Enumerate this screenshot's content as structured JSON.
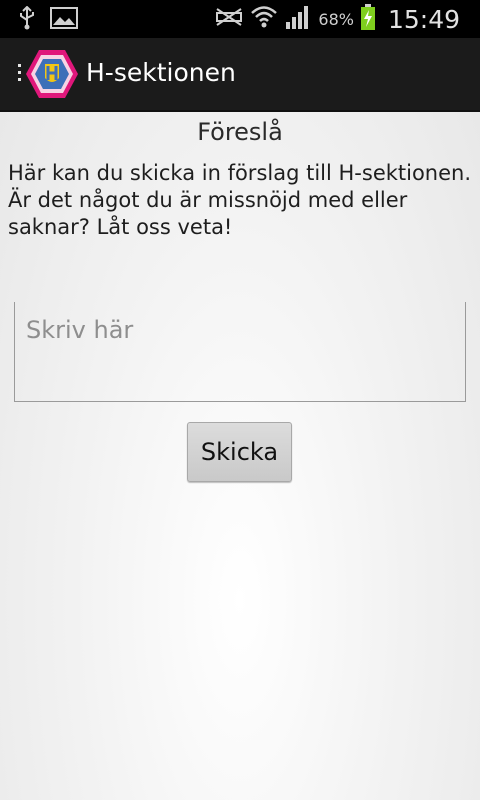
{
  "status_bar": {
    "battery_percent": "68%",
    "time": "15:49",
    "icons": [
      "usb-icon",
      "image-icon",
      "mute-icon",
      "wifi-icon",
      "signal-icon",
      "battery-charging-icon"
    ]
  },
  "action_bar": {
    "title": "H-sektionen",
    "logo": "h-sektionen-logo",
    "accent": "#e0177b"
  },
  "main": {
    "title": "Föreslå",
    "intro": "Här kan du skicka in förslag till H-sektionen. Är det något du är missnöjd med eller saknar? Låt oss veta!",
    "input": {
      "placeholder": "Skriv här",
      "value": ""
    },
    "submit_label": "Skicka"
  }
}
